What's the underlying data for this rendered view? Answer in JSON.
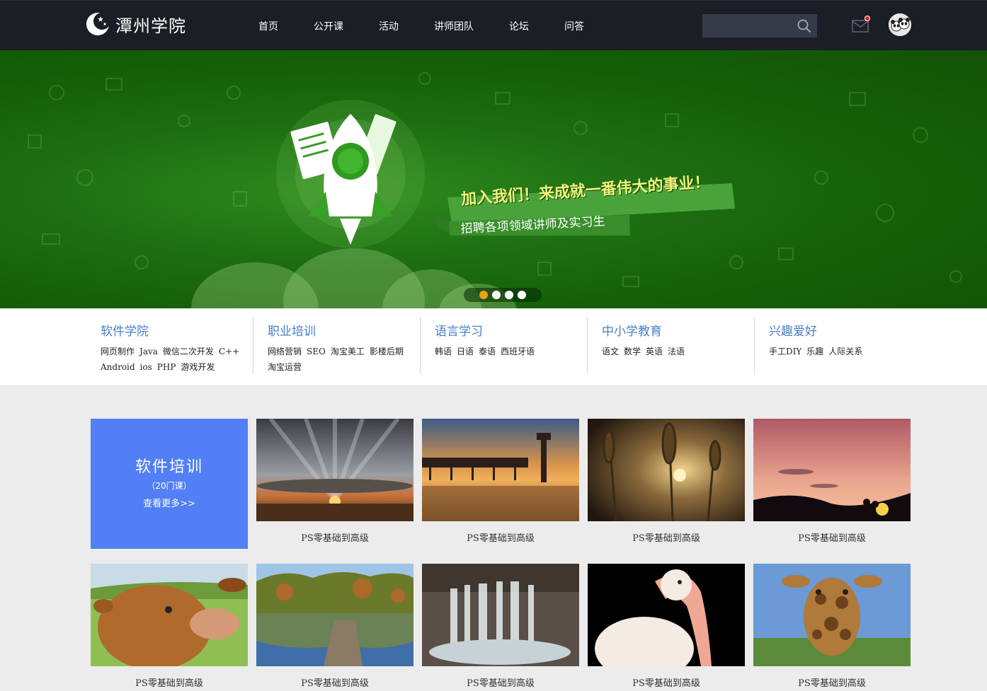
{
  "header": {
    "logo_text": "潭州学院",
    "nav": [
      "首页",
      "公开课",
      "活动",
      "讲师团队",
      "论坛",
      "问答"
    ],
    "search_placeholder": ""
  },
  "banner": {
    "slogan": "加入我们！来成就一番伟大的事业！",
    "sub_slogan": "招聘各项领域讲师及实习生",
    "slide_count": 4,
    "active_slide": 1
  },
  "categories": [
    {
      "title": "软件学院",
      "links": [
        "网页制作",
        "Java",
        "微信二次开发",
        "C++",
        "Android",
        "ios",
        "PHP",
        "游戏开发"
      ]
    },
    {
      "title": "职业培训",
      "links": [
        "网络营销",
        "SEO",
        "淘宝美工",
        "影楼后期",
        "淘宝运营"
      ]
    },
    {
      "title": "语言学习",
      "links": [
        "韩语",
        "日语",
        "泰语",
        "西班牙语"
      ]
    },
    {
      "title": "中小学教育",
      "links": [
        "语文",
        "数学",
        "英语",
        "法语"
      ]
    },
    {
      "title": "兴趣爱好",
      "links": [
        "手工DIY",
        "乐趣",
        "人际关系"
      ]
    }
  ],
  "feature": {
    "title": "软件培训",
    "count": "（20门课）",
    "more": "查看更多>>"
  },
  "courses": [
    {
      "label": "PS零基础到高级",
      "image": "sunset-clouds"
    },
    {
      "label": "PS零基础到高级",
      "image": "pier-sunset"
    },
    {
      "label": "PS零基础到高级",
      "image": "grass-sunset"
    },
    {
      "label": "PS零基础到高级",
      "image": "pink-sky-silhouette"
    },
    {
      "label": "PS零基础到高级",
      "image": "cow"
    },
    {
      "label": "PS零基础到高级",
      "image": "lake-forest"
    },
    {
      "label": "PS零基础到高级",
      "image": "waterfall"
    },
    {
      "label": "PS零基础到高级",
      "image": "pelican"
    },
    {
      "label": "PS零基础到高级",
      "image": "giraffe"
    }
  ],
  "colors": {
    "header_bg": "#1b1e25",
    "banner_green": "#1d6e12",
    "category_title": "#4a7ec8",
    "feature_blue": "#527ff5",
    "active_dot": "#f0a018"
  }
}
